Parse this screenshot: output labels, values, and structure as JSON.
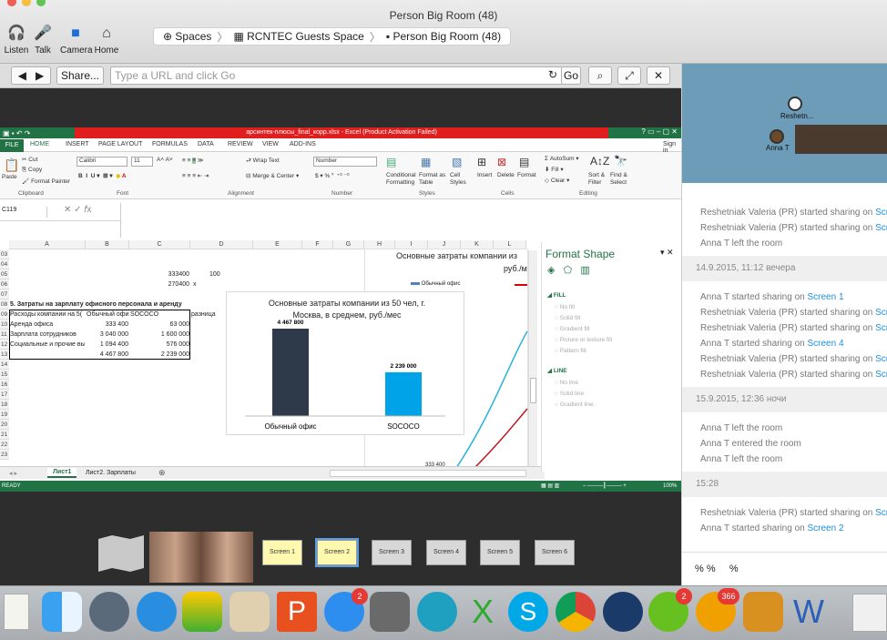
{
  "window": {
    "title": "Person Big Room (48)"
  },
  "toolbar": {
    "listen": "Listen",
    "talk": "Talk",
    "camera": "Camera",
    "home": "Home"
  },
  "breadcrumb": [
    "Spaces",
    "RCNTEC Guests Space",
    "Person Big Room (48)"
  ],
  "browser": {
    "share": "Share...",
    "url_placeholder": "Type a URL and click Go",
    "go": "Go"
  },
  "excel": {
    "title": "арсинтек-плюсы_final_корр.xlsx - Excel (Product Activation Failed)",
    "tabs": [
      "FILE",
      "HOME",
      "INSERT",
      "PAGE LAYOUT",
      "FORMULAS",
      "DATA",
      "REVIEW",
      "VIEW",
      "ADD-INS"
    ],
    "sign_in": "Sign in",
    "ribbon": {
      "paste": "Paste",
      "cut": "Cut",
      "copy": "Copy",
      "format_painter": "Format Painter",
      "font": "Calibri",
      "size": "11",
      "wrap": "Wrap Text",
      "merge": "Merge & Center",
      "number_format": "Number",
      "cond": "Conditional Formatting",
      "fmt_table": "Format as Table",
      "cell_styles": "Cell Styles",
      "insert": "Insert",
      "delete": "Delete",
      "format": "Format",
      "autosum": "AutoSum",
      "fill": "Fill",
      "clear": "Clear",
      "sort": "Sort & Filter",
      "find": "Find & Select",
      "groups": [
        "Clipboard",
        "Font",
        "Alignment",
        "Number",
        "Styles",
        "Cells",
        "Editing"
      ]
    },
    "name_box": "C119",
    "columns": [
      "A",
      "B",
      "C",
      "D",
      "E",
      "F",
      "G",
      "H",
      "I",
      "J",
      "K",
      "L"
    ],
    "rows": [
      "03",
      "04",
      "05",
      "06",
      "07",
      "08",
      "09",
      "10",
      "11",
      "12",
      "13",
      "14",
      "15",
      "16",
      "17",
      "18",
      "19",
      "20",
      "21",
      "22",
      "23"
    ],
    "cells": {
      "c05": "333400",
      "d05": "100",
      "c06": "270400",
      "d06": "x",
      "a08": "5. Затраты на зарплату офисного персонала и аренду",
      "a09": "Расходы компании на 5(",
      "b09": "Обычный офис",
      "c09": "SOCOCO",
      "d09": "разница",
      "a10": "Аренда офиса",
      "b10": "333 400",
      "c10": "63 000",
      "a11": "Зарплата сотрудников",
      "b11": "3 040 000",
      "c11": "1 600 000",
      "a12": "Социальные и прочие вы",
      "b12": "1 094 400",
      "c12": "576 000",
      "b13": "4 467 800",
      "c13": "2 239 000"
    },
    "sheets": [
      "Лист1",
      "Лист2. Зарплаты"
    ],
    "status": "READY",
    "zoom": "100%",
    "bg_chart_title": "Основные затраты компании из",
    "bg_chart_subtitle": "руб./м",
    "bg_chart_legend": "Обычный офис",
    "bg_chart_axis": "333 400",
    "format_pane": {
      "title": "Format Shape",
      "fill": "FILL",
      "fill_opts": [
        "No fill",
        "Solid fill",
        "Gradient fill",
        "Picture or texture fill",
        "Pattern fill"
      ],
      "line": "LINE",
      "line_opts": [
        "No line",
        "Solid line",
        "Gradient line"
      ]
    }
  },
  "chart_data": {
    "type": "bar",
    "title": "Основные затраты компании из 50 чел, г. Москва, в среднем, руб./мес",
    "categories": [
      "Обычный офис",
      "SOCOCO"
    ],
    "values": [
      4467800,
      2239000
    ],
    "labels": [
      "4 467 800",
      "2 239 000"
    ],
    "colors": [
      "#2e3a4a",
      "#00a2e8"
    ],
    "ylim": [
      0,
      4467800
    ]
  },
  "screens": [
    "Screen 1",
    "Screen 2",
    "Screen 3",
    "Screen 4",
    "Screen 5",
    "Screen 6"
  ],
  "map": {
    "user1": "Reshetn...",
    "user2": "Anna T"
  },
  "log": [
    {
      "text": "Reshetniak Valeria (PR) started sharing on ",
      "link": "Screen"
    },
    {
      "text": "Reshetniak Valeria (PR) started sharing on ",
      "link": "Screen"
    },
    {
      "text": "Anna T left the room",
      "link": ""
    }
  ],
  "date1": "14.9.2015, 11:12 вечера",
  "log2": [
    {
      "text": "Anna T started sharing on ",
      "link": "Screen 1"
    },
    {
      "text": "Reshetniak Valeria (PR) started sharing on ",
      "link": "Screen"
    },
    {
      "text": "Reshetniak Valeria (PR) started sharing on ",
      "link": "Screen"
    },
    {
      "text": "Anna T started sharing on ",
      "link": "Screen 4"
    },
    {
      "text": "Reshetniak Valeria (PR) started sharing on ",
      "link": "Screen"
    },
    {
      "text": "Reshetniak Valeria (PR) started sharing on ",
      "link": "Screen"
    }
  ],
  "date2": "15.9.2015, 12:36 ночи",
  "log3": [
    {
      "text": "Anna T left the room",
      "link": ""
    },
    {
      "text": "Anna T entered the room",
      "link": ""
    },
    {
      "text": "Anna T left the room",
      "link": ""
    }
  ],
  "date3": "15:28",
  "log4": [
    {
      "text": "Reshetniak Valeria (PR) started sharing on ",
      "link": "Screen"
    },
    {
      "text": "Anna T started sharing on ",
      "link": "Screen 2"
    }
  ],
  "chat_input": "% %     %",
  "dock_badges": {
    "appstore": "2",
    "icq": "2",
    "ok": "366"
  }
}
